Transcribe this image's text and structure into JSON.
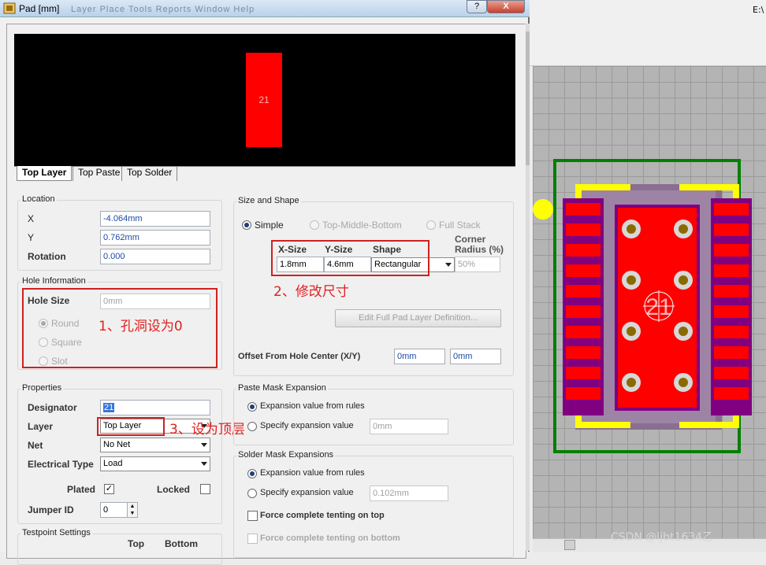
{
  "window": {
    "title": "Pad [mm]",
    "menu_ghost": "Layer   Place   Tools   Reports   Window   Help",
    "help": "?",
    "close": "X"
  },
  "background": {
    "path": "E:\\",
    "watermark": "CSDN @ljbt1634乙"
  },
  "preview": {
    "pad_number": "21",
    "pad_color": "#ff0000"
  },
  "tabs": [
    "Top Layer",
    "Top Paste",
    "Top Solder"
  ],
  "location": {
    "title": "Location",
    "x_label": "X",
    "x_value": "-4.064mm",
    "y_label": "Y",
    "y_value": "0.762mm",
    "rotation_label": "Rotation",
    "rotation_value": "0.000"
  },
  "hole": {
    "title": "Hole Information",
    "size_label": "Hole Size",
    "size_value": "0mm",
    "round": "Round",
    "square": "Square",
    "slot": "Slot",
    "annotation": "1、孔洞设为0"
  },
  "properties": {
    "title": "Properties",
    "designator_label": "Designator",
    "designator_value": "21",
    "layer_label": "Layer",
    "layer_value": "Top Layer",
    "net_label": "Net",
    "net_value": "No Net",
    "etype_label": "Electrical Type",
    "etype_value": "Load",
    "plated_label": "Plated",
    "plated_check": "✓",
    "locked_label": "Locked",
    "jumper_label": "Jumper ID",
    "jumper_value": "0",
    "annotation": "3、设为顶层"
  },
  "testpoint": {
    "title": "Testpoint Settings",
    "top": "Top",
    "bottom": "Bottom"
  },
  "size_shape": {
    "title": "Size and Shape",
    "simple": "Simple",
    "tmb": "Top-Middle-Bottom",
    "full": "Full Stack",
    "xsize_label": "X-Size",
    "ysize_label": "Y-Size",
    "shape_label": "Shape",
    "corner_label_1": "Corner",
    "corner_label_2": "Radius (%)",
    "xsize_value": "1.8mm",
    "ysize_value": "4.6mm",
    "shape_value": "Rectangular",
    "corner_value": "50%",
    "edit_button": "Edit Full Pad Layer Definition...",
    "offset_label": "Offset From Hole Center (X/Y)",
    "offset_x": "0mm",
    "offset_y": "0mm",
    "annotation": "2、修改尺寸"
  },
  "paste_mask": {
    "title": "Paste Mask Expansion",
    "from_rules": "Expansion value from rules",
    "specify": "Specify expansion value",
    "specify_value": "0mm"
  },
  "solder_mask": {
    "title": "Solder Mask Expansions",
    "from_rules": "Expansion value from rules",
    "specify": "Specify expansion value",
    "specify_value": "0.102mm",
    "tent_top": "Force complete tenting on top",
    "tent_bottom": "Force complete tenting on bottom"
  },
  "pcb": {
    "component_label": "21"
  },
  "colors": {
    "pad": "#ff0000",
    "silk": "#ffff00",
    "outline": "#008000",
    "body": "#800080"
  }
}
